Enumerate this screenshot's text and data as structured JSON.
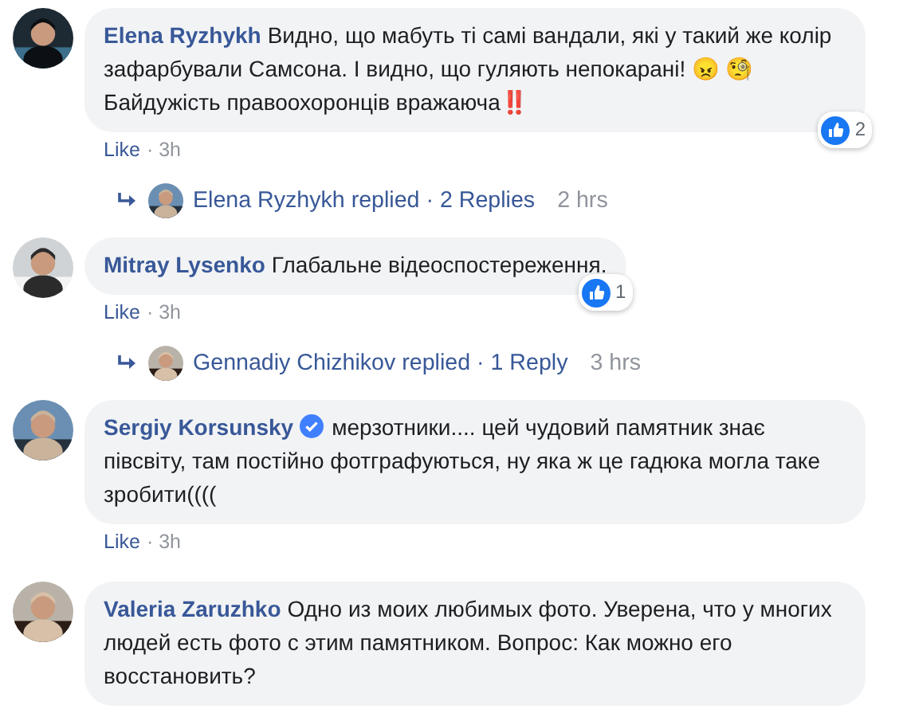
{
  "comments": [
    {
      "author": "Elena Ryzhykh",
      "verified": false,
      "text": "Видно, що мабуть ті самі вандали, які у такий же колір зафарбували Самсона. І видно, що гуляють непокарані! 😠 🧐 Байдужість правоохоронців вражаюча‼️",
      "reactions": "2",
      "like": "Like",
      "time": "· 3h",
      "replies": {
        "link": "Elena Ryzhykh replied · 2 Replies",
        "time": "2 hrs"
      }
    },
    {
      "author": "Mitray Lysenko",
      "verified": false,
      "text": "Глабальне відеоспостереження.",
      "reactions": "1",
      "like": "Like",
      "time": "· 3h",
      "replies": {
        "link": "Gennadiy Chizhikov replied · 1 Reply",
        "time": "3 hrs"
      }
    },
    {
      "author": "Sergiy Korsunsky",
      "verified": true,
      "text": "мерзотники.... цей чудовий памятник знає півсвіту, там постійно фотграфуються, ну яка ж це гадюка могла таке зробити((((",
      "like": "Like",
      "time": "· 3h"
    },
    {
      "author": "Valeria Zaruzhko",
      "verified": false,
      "text": "Одно из моих любимых фото. Уверена, что у многих людей есть фото с этим памятником. Вопрос: Как можно его восстановить?"
    }
  ]
}
